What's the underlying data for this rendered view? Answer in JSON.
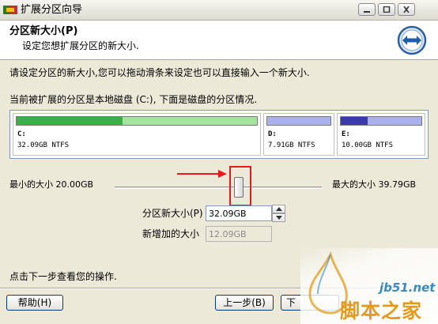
{
  "window": {
    "title": "扩展分区向导"
  },
  "header": {
    "title": "分区新大小(P)",
    "subtitle": "设定您想扩展分区的新大小."
  },
  "intro_text": "请设定分区的新大小,您可以拖动滑条来设定也可以直接输入一个新大小.",
  "current_text": "当前被扩展的分区是本地磁盘 (C:), 下面是磁盘的分区情况.",
  "partitions": [
    {
      "letter": "C:",
      "info": "32.09GB NTFS",
      "used_fraction": 0.44,
      "color": "#3fae46"
    },
    {
      "letter": "D:",
      "info": "7.91GB NTFS",
      "used_fraction": 0.0,
      "color": "#3c3ca8"
    },
    {
      "letter": "E:",
      "info": "10.00GB NTFS",
      "used_fraction": 0.33,
      "color": "#3c3ca8"
    }
  ],
  "slider": {
    "min_label": "最小的大小 20.00GB",
    "max_label": "最大的大小 39.79GB"
  },
  "new_size": {
    "label": "分区新大小(P)",
    "value": "32.09GB"
  },
  "added_size": {
    "label": "新增加的大小",
    "value": "12.09GB"
  },
  "footer_text": "点击下一步查看您的操作.",
  "buttons": {
    "help": "帮助(H)",
    "back": "上一步(B)",
    "next": "下"
  },
  "watermark": {
    "url": "jb51.net",
    "name": "脚本之家"
  },
  "colors": {
    "accent_blue": "#1f5ea8",
    "highlight_red": "#e51b1b"
  }
}
